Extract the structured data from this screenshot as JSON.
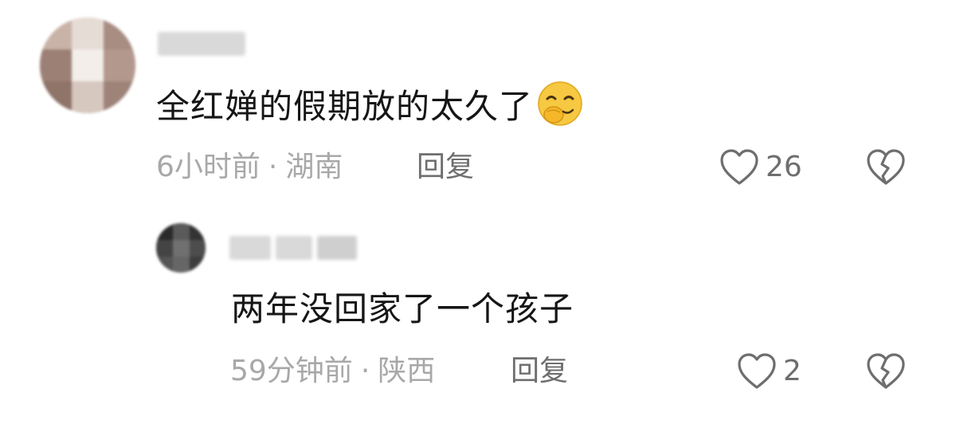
{
  "comments": [
    {
      "text": "全红婵的假期放的太久了",
      "emoji": "smirk-hand-emoji",
      "time": "6小时前",
      "location": "湖南",
      "separator": "·",
      "reply_label": "回复",
      "likes": "26",
      "is_reply": false
    },
    {
      "text": "两年没回家了一个孩子",
      "time": "59分钟前",
      "location": "陕西",
      "separator": "·",
      "reply_label": "回复",
      "likes": "2",
      "is_reply": true
    }
  ],
  "colors": {
    "text": "#161616",
    "meta": "#a8a8a8",
    "action": "#6e6e6e",
    "emoji_yellow": "#f7c842"
  },
  "icons": {
    "like": "heart-outline-icon",
    "dislike": "broken-heart-icon"
  }
}
